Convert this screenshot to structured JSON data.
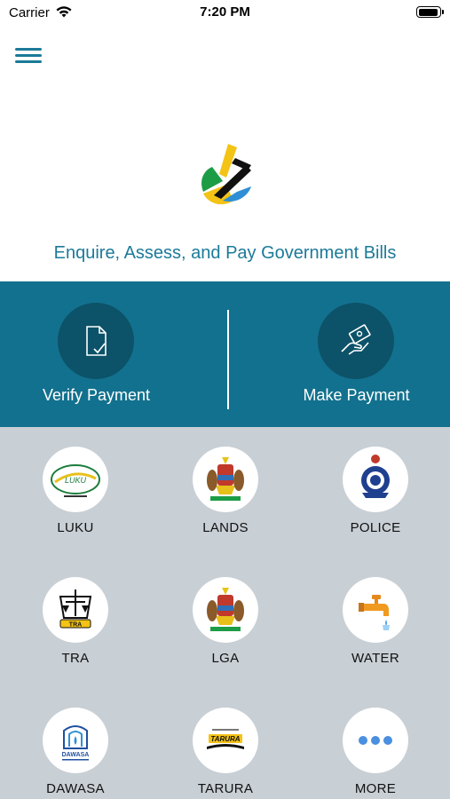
{
  "status_bar": {
    "carrier": "Carrier",
    "time": "7:20 PM"
  },
  "header": {
    "tagline": "Enquire, Assess, and Pay Government Bills"
  },
  "actions": {
    "verify_label": "Verify Payment",
    "make_label": "Make Payment"
  },
  "services": [
    {
      "label": "LUKU",
      "icon": "luku-logo-icon"
    },
    {
      "label": "LANDS",
      "icon": "coat-of-arms-icon"
    },
    {
      "label": "POLICE",
      "icon": "police-badge-icon"
    },
    {
      "label": "TRA",
      "icon": "tra-logo-icon"
    },
    {
      "label": "LGA",
      "icon": "coat-of-arms-icon"
    },
    {
      "label": "WATER",
      "icon": "water-tap-icon"
    },
    {
      "label": "DAWASA",
      "icon": "dawasa-logo-icon"
    },
    {
      "label": "TARURA",
      "icon": "tarura-logo-icon"
    },
    {
      "label": "MORE",
      "icon": "more-dots-icon"
    }
  ],
  "colors": {
    "brand_teal": "#12718e",
    "brand_dark": "#0c5268",
    "grid_bg": "#c8cfd5",
    "text_teal": "#1b7a99"
  }
}
